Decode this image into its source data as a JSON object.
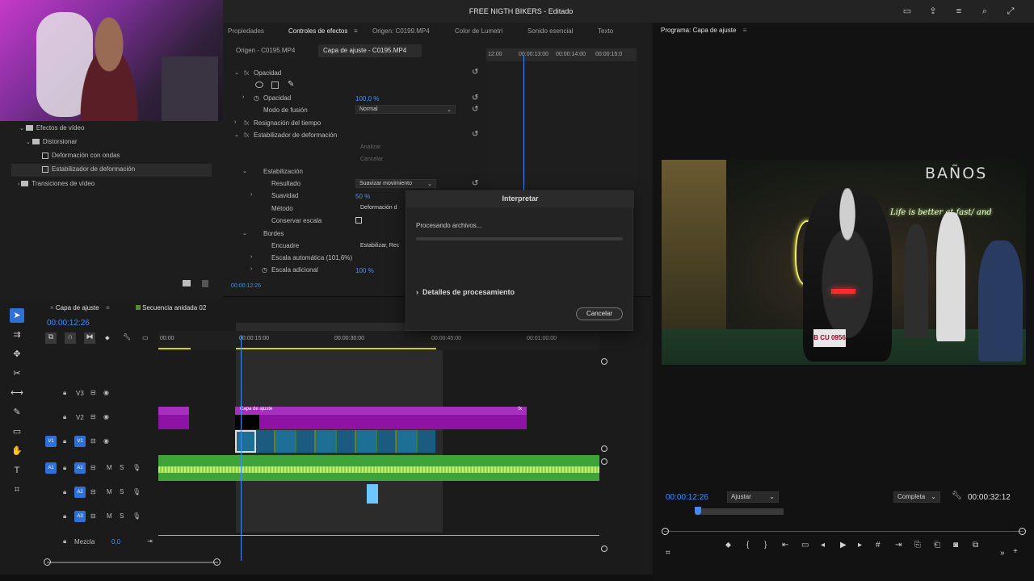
{
  "app_title": "FREE NIGTH BIKERS - Editado",
  "effects_panel": {
    "tabs": [
      "Propiedades",
      "Controles de efectos",
      "Origen: C0199.MP4",
      "Color de Lumetri",
      "Sonido esencial",
      "Texto"
    ],
    "active_tab": "Controles de efectos",
    "source_tabs": [
      "Origen - C0195.MP4",
      "Capa de ajuste - C0195.MP4"
    ],
    "opacity_section": "Opacidad",
    "opacity_label": "Opacidad",
    "opacity_value": "100,0 %",
    "blend_label": "Modo de fusión",
    "blend_value": "Normal",
    "time_remap": "Resignación del tiempo",
    "stabilizer": "Estabilizador de deformación",
    "analyze_label": "Analizar",
    "cancel_label": "Cancelar",
    "stabilization": "Estabilización",
    "result_label": "Resultado",
    "result_value": "Suavizar movimiento",
    "smooth_label": "Suavidad",
    "smooth_value": "50 %",
    "method_label": "Método",
    "method_value": "Deformación d",
    "preserve_label": "Conservar escala",
    "borders_label": "Bordes",
    "framing_label": "Encuadre",
    "framing_value": "Estabilizar, Rec",
    "autoscale_label": "Escala automática (101,6%)",
    "extra_scale_label": "Escala adicional",
    "extra_scale_value": "100 %",
    "ruler_ticks": [
      "12:00",
      "00:00:13:00",
      "00:00:14:00",
      "00:00:15:0"
    ],
    "timecode": "00:00:12:26"
  },
  "effects_tree": {
    "items": [
      "Efectos de vídeo",
      "Distorsionar",
      "Deformación con ondas",
      "Estabilizador de deformación",
      "Transiciones de vídeo"
    ]
  },
  "program": {
    "header": "Programa: Capa de ajuste",
    "sign": "BAÑOS",
    "neon": "Life is better at fast/ and",
    "plate": "B CU 0956",
    "time_current": "00:00:12:26",
    "fit": "Ajustar",
    "quality": "Completa",
    "time_total": "00:00:32:12"
  },
  "timeline": {
    "tabs": [
      "Capa de ajuste",
      "Secuencia anidada 02"
    ],
    "time": "00:00:12:26",
    "ruler": [
      "00:00",
      "00:00:15:00",
      "00:00:30:00",
      "00:00:45:00",
      "00:01:00:00"
    ],
    "tracks": [
      "V3",
      "V2",
      "V1",
      "A1",
      "A2",
      "A3"
    ],
    "mix_label": "Mezcla",
    "mix_value": "0,0",
    "adj_clip_label": "Capa de ajuste"
  },
  "dialog": {
    "title": "Interpretar",
    "status": "Procesando archivos...",
    "details": "Detalles de procesamiento",
    "cancel": "Cancelar"
  }
}
